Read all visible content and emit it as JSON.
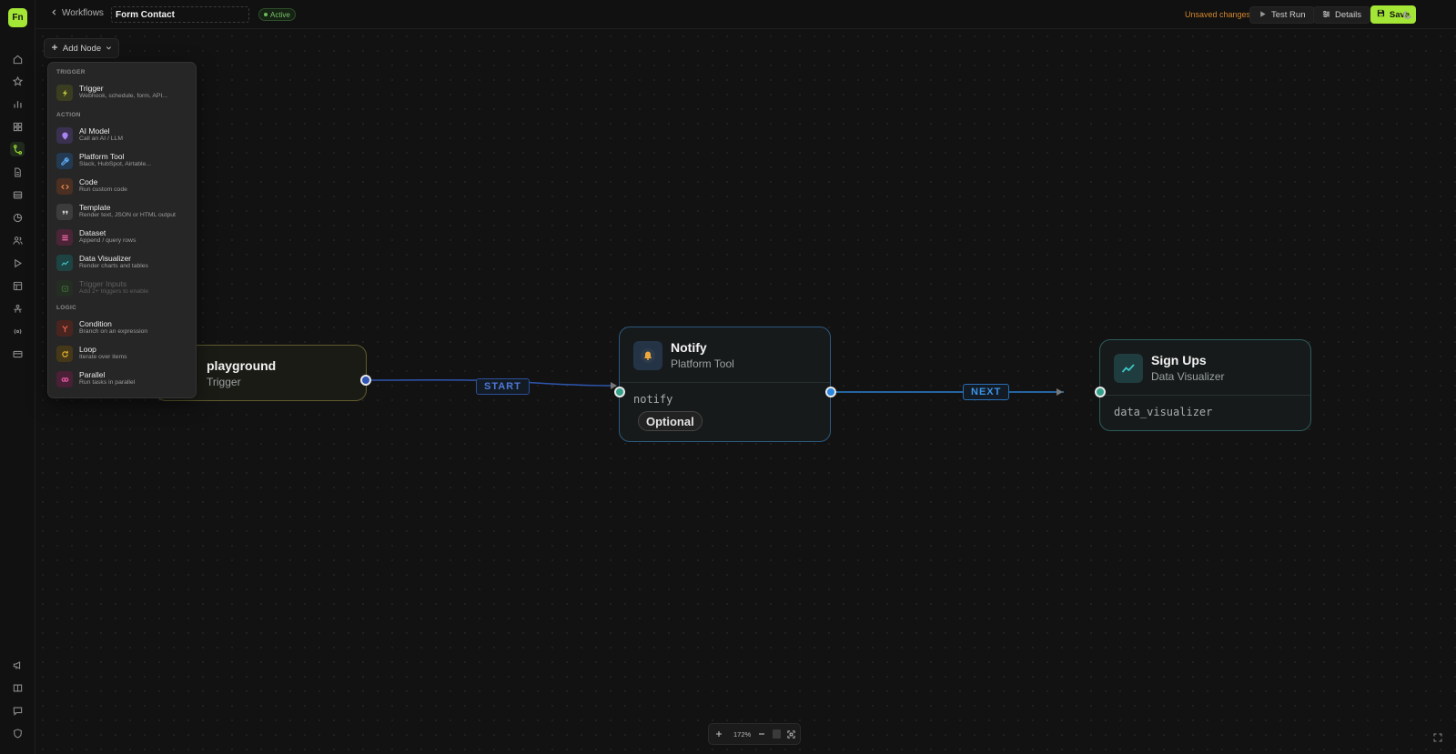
{
  "app": {
    "logo_text": "Fn",
    "accent_color": "#a3e635"
  },
  "sidebar": {
    "top_icons": [
      "home-icon",
      "star-icon",
      "bar-chart-icon",
      "grid-icon",
      "workflow-icon",
      "document-icon",
      "database-icon",
      "pie-chart-icon",
      "users-icon",
      "play-icon",
      "table-icon",
      "agent-icon",
      "broadcast-icon",
      "card-icon"
    ],
    "active_icon": "workflow-icon",
    "bottom_icons": [
      "megaphone-icon",
      "book-icon",
      "chat-icon",
      "shield-icon"
    ]
  },
  "header": {
    "back_label": "Workflows",
    "workflow_name": "Form Contact",
    "status_label": "Active",
    "unsaved_label": "Unsaved changes",
    "test_run_label": "Test Run",
    "details_label": "Details",
    "save_label": "Save"
  },
  "canvas": {
    "add_node_label": "Add Node",
    "zoom_level": "172%"
  },
  "menu": {
    "sections": [
      {
        "title": "TRIGGER",
        "items": [
          {
            "title": "Trigger",
            "desc": "Webhook, schedule, form, API...",
            "icon": "bolt-icon",
            "color": "#b7c23a",
            "bg": "#3a3d20"
          }
        ]
      },
      {
        "title": "ACTION",
        "items": [
          {
            "title": "AI Model",
            "desc": "Call an AI / LLM",
            "icon": "ai-icon",
            "color": "#a884f0",
            "bg": "#3a3050"
          },
          {
            "title": "Platform Tool",
            "desc": "Slack, HubSpot, Airtable...",
            "icon": "wrench-icon",
            "color": "#5aa4e8",
            "bg": "#233a52"
          },
          {
            "title": "Code",
            "desc": "Run custom code",
            "icon": "code-icon",
            "color": "#e88a4e",
            "bg": "#4a2f22"
          },
          {
            "title": "Template",
            "desc": "Render text, JSON or HTML output",
            "icon": "quote-icon",
            "color": "#d0d0d0",
            "bg": "#3c3c3c"
          },
          {
            "title": "Dataset",
            "desc": "Append / query rows",
            "icon": "rows-icon",
            "color": "#ee6aa6",
            "bg": "#4c2438"
          },
          {
            "title": "Data Visualizer",
            "desc": "Render charts and tables",
            "icon": "chart-line-icon",
            "color": "#3ec5c5",
            "bg": "#1e4343"
          },
          {
            "title": "Trigger Inputs",
            "desc": "Add 2+ triggers to enable",
            "icon": "inputs-icon",
            "color": "#58b04a",
            "bg": "#22381f",
            "disabled": true
          }
        ]
      },
      {
        "title": "LOGIC",
        "items": [
          {
            "title": "Condition",
            "desc": "Branch on an expression",
            "icon": "branch-icon",
            "color": "#e8604a",
            "bg": "#4a2520"
          },
          {
            "title": "Loop",
            "desc": "Iterate over items",
            "icon": "loop-icon",
            "color": "#e0b030",
            "bg": "#453818"
          },
          {
            "title": "Parallel",
            "desc": "Run tasks in parallel",
            "icon": "parallel-icon",
            "color": "#ee5aa8",
            "bg": "#4a2036"
          }
        ]
      }
    ]
  },
  "nodes": {
    "trigger": {
      "title": "playground",
      "subtitle": "Trigger"
    },
    "notify": {
      "title": "Notify",
      "subtitle": "Platform Tool",
      "slug": "notify",
      "badge": "Optional"
    },
    "signups": {
      "title": "Sign Ups",
      "subtitle": "Data Visualizer",
      "slug": "data_visualizer"
    }
  },
  "edges": {
    "start_label": "START",
    "next_label": "NEXT",
    "start_color": "#4a78d8",
    "next_color": "#2a8ee0"
  }
}
